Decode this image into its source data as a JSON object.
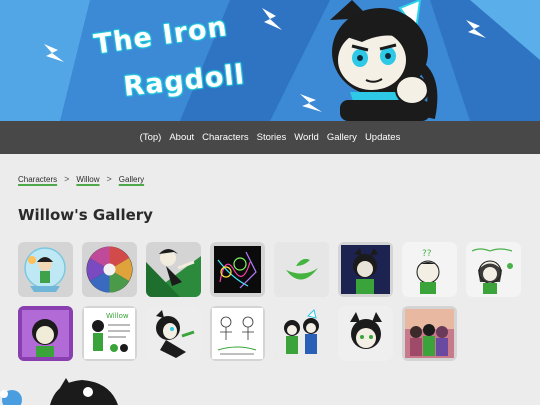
{
  "site": {
    "logo_line1": "The Iron",
    "logo_line2": "Ragdoll"
  },
  "nav": {
    "items": [
      "(Top)",
      "About",
      "Characters",
      "Stories",
      "World",
      "Gallery",
      "Updates"
    ]
  },
  "breadcrumb": {
    "items": [
      "Characters",
      "Willow",
      "Gallery"
    ],
    "separator": ">"
  },
  "page": {
    "title": "Willow's Gallery"
  },
  "gallery": {
    "thumbnails": [
      {
        "icon": "willow-in-snow-globe-thumbnail"
      },
      {
        "icon": "color-wheel-thumbnail"
      },
      {
        "icon": "willow-action-pose-thumbnail"
      },
      {
        "icon": "neon-sketch-thumbnail"
      },
      {
        "icon": "green-leaf-logo-thumbnail"
      },
      {
        "icon": "willow-dark-portrait-thumbnail"
      },
      {
        "icon": "willow-question-thumbnail"
      },
      {
        "icon": "willow-doodle-thumbnail"
      },
      {
        "icon": "willow-purple-portrait-thumbnail"
      },
      {
        "icon": "willow-reference-sheet-thumbnail"
      },
      {
        "icon": "willow-side-pose-thumbnail"
      },
      {
        "icon": "willow-comic-sketch-thumbnail"
      },
      {
        "icon": "willow-duo-thumbnail"
      },
      {
        "icon": "willow-face-thumbnail"
      },
      {
        "icon": "group-photo-thumbnail"
      }
    ]
  },
  "colors": {
    "banner_bg": "#3f8ed8",
    "nav_bg": "#484848",
    "page_bg": "#ececec",
    "accent_green": "#4fa84a",
    "thumb_bg": "#d4d4d4"
  }
}
